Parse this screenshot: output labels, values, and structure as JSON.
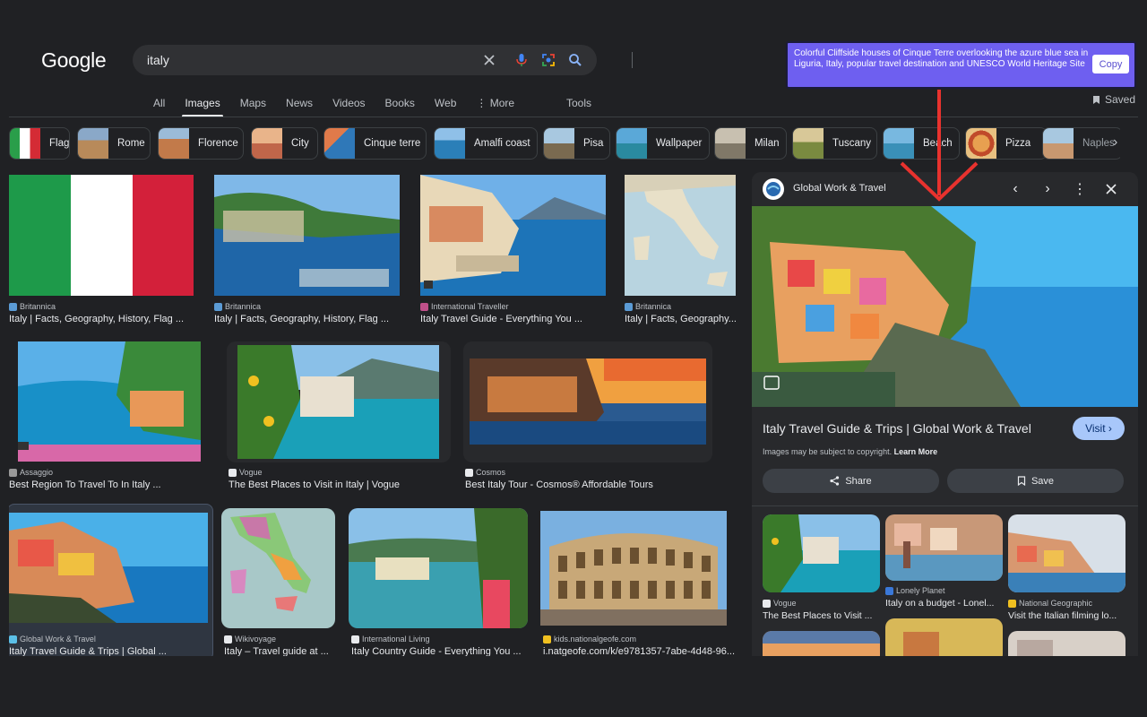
{
  "header": {
    "logo": "Google",
    "search": {
      "value": "italy"
    },
    "icons": [
      "close-icon",
      "mic-icon",
      "lens-icon",
      "search-icon"
    ]
  },
  "tabs": [
    {
      "label": "All"
    },
    {
      "label": "Images",
      "active": true
    },
    {
      "label": "Maps"
    },
    {
      "label": "News"
    },
    {
      "label": "Videos"
    },
    {
      "label": "Books"
    },
    {
      "label": "Web"
    },
    {
      "label": "⋮ More"
    }
  ],
  "tools_label": "Tools",
  "saved_label": "Saved",
  "chips": [
    "Flag",
    "Rome",
    "Florence",
    "City",
    "Cinque terre",
    "Amalfi coast",
    "Pisa",
    "Wallpaper",
    "Milan",
    "Tuscany",
    "Beach",
    "Pizza",
    "Naples"
  ],
  "results": [
    {
      "source": "Britannica",
      "title": "Italy | Facts, Geography, History, Flag ..."
    },
    {
      "source": "Britannica",
      "title": "Italy | Facts, Geography, History, Flag ..."
    },
    {
      "source": "International Traveller",
      "title": "Italy Travel Guide - Everything You ..."
    },
    {
      "source": "Britannica",
      "title": "Italy | Facts, Geography..."
    },
    {
      "source": "Assaggio",
      "title": "Best Region To Travel To In Italy ..."
    },
    {
      "source": "Vogue",
      "title": "The Best Places to Visit in Italy | Vogue"
    },
    {
      "source": "Cosmos",
      "title": "Best Italy Tour - Cosmos® Affordable Tours"
    },
    {
      "source": "Global Work & Travel",
      "title": "Italy Travel Guide & Trips | Global ..."
    },
    {
      "source": "Wikivoyage",
      "title": "Italy – Travel guide at ..."
    },
    {
      "source": "International Living",
      "title": "Italy Country Guide - Everything You ..."
    },
    {
      "source": "kids.nationalgeofe.com",
      "title": "i.natgeofe.com/k/e9781357-7abe-4d48-96..."
    }
  ],
  "panel": {
    "source": "Global Work & Travel",
    "title": "Italy Travel Guide & Trips | Global Work & Travel",
    "visit_label": "Visit",
    "copyright_text": "Images may be subject to copyright.",
    "learn_more": "Learn More",
    "share_label": "Share",
    "save_label": "Save",
    "related": [
      {
        "source": "Vogue",
        "title": "The Best Places to Visit ..."
      },
      {
        "source": "Lonely Planet",
        "title": "Italy on a budget - Lonel..."
      },
      {
        "source": "National Geographic",
        "title": "Visit the Italian filming lo..."
      }
    ]
  },
  "tooltip": {
    "text": "Colorful Cliffside houses of Cinque Terre overlooking the azure blue sea in Liguria, Italy, popular travel destination and UNESCO World Heritage Site",
    "copy_label": "Copy"
  },
  "colors": {
    "accent": "#a8c7fa",
    "tooltip_bg": "#6e5ff0",
    "arrow": "#e8322e"
  }
}
